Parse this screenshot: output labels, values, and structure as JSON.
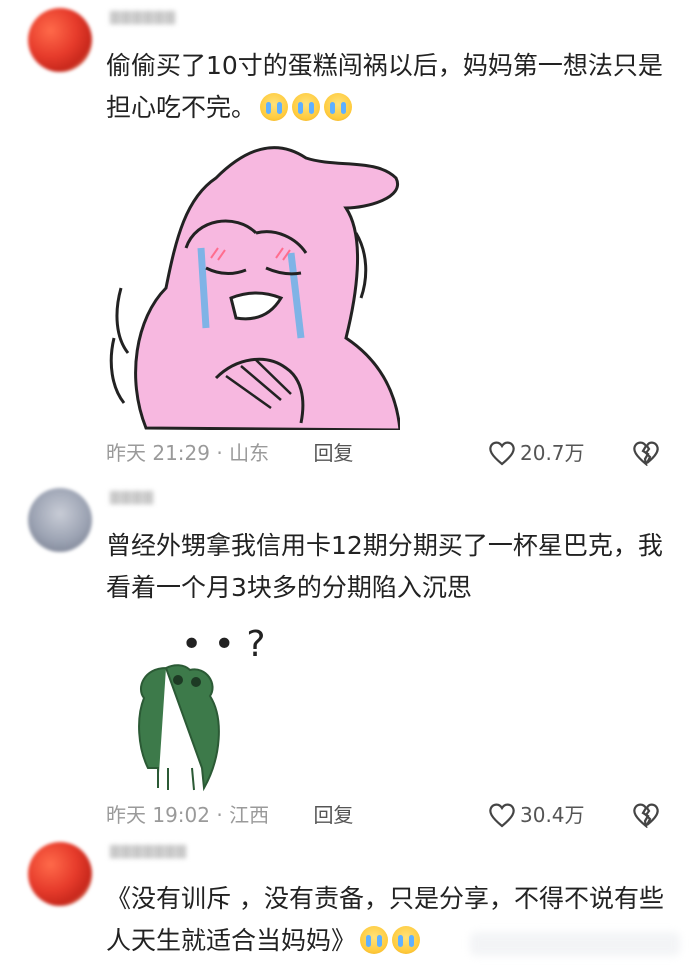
{
  "comments": [
    {
      "text": "偷偷买了10寸的蛋糕闯祸以后，妈妈第一想法只是担心吃不完。",
      "emoji_count": 3,
      "emoji_icon": "loudly-crying-face-icon",
      "sticker": "crying-pink-character-sticker",
      "time": "昨天 21:29",
      "location": "山东",
      "reply_label": "回复",
      "likes": "20.7万"
    },
    {
      "text": "曾经外甥拿我信用卡12期分期买了一杯星巴克，我看着一个月3块多的分期陷入沉思",
      "sticker": "confused-frog-sticker",
      "sticker_text": "• • ?",
      "time": "昨天 19:02",
      "location": "江西",
      "reply_label": "回复",
      "likes": "30.4万"
    },
    {
      "text": "《没有训斥 ，没有责备，只是分享，不得不说有些人天生就适合当妈妈》",
      "emoji_count": 2,
      "emoji_icon": "loudly-crying-face-icon"
    }
  ],
  "colors": {
    "text": "#222222",
    "meta": "#9a9a9a",
    "pink_character": "#f7b8e0"
  }
}
